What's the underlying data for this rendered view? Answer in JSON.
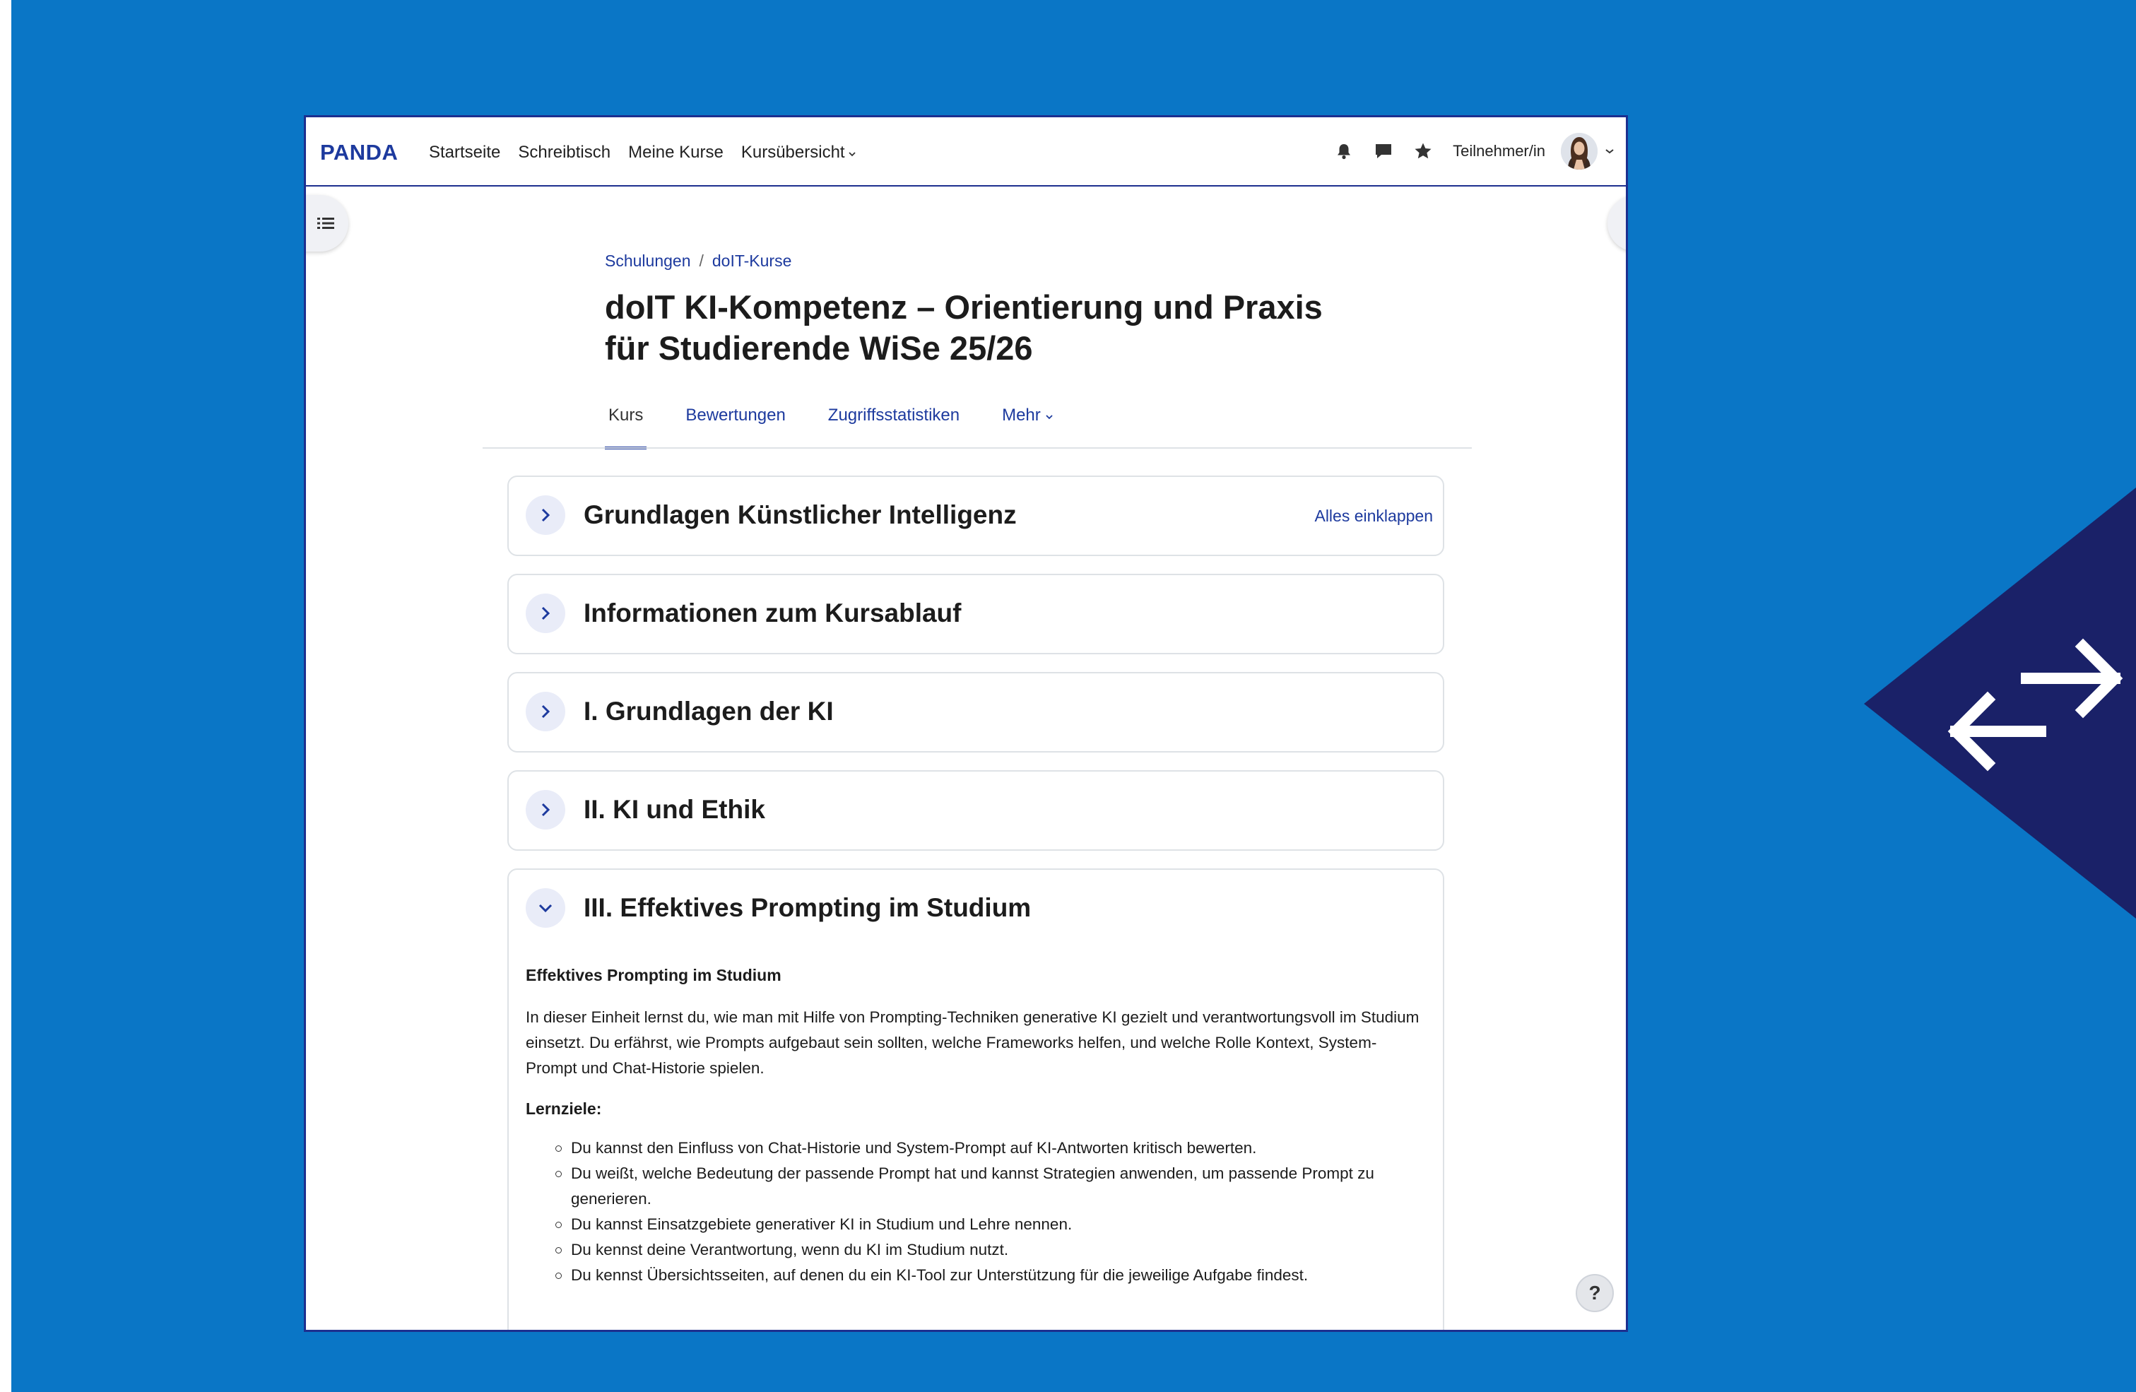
{
  "colors": {
    "background": "#0a76c6",
    "brand": "#1d3a9e",
    "deco": "#1a2168",
    "link": "#1d3a9e"
  },
  "navbar": {
    "brand": "PANDA",
    "links": [
      "Startseite",
      "Schreibtisch",
      "Meine Kurse",
      "Kursübersicht"
    ],
    "role": "Teilnehmer/in",
    "icons": [
      "bell-icon",
      "chat-icon",
      "star-icon"
    ]
  },
  "breadcrumb": [
    "Schulungen",
    "doIT-Kurse"
  ],
  "page": {
    "title_line1": "doIT KI-Kompetenz – Orientierung und Praxis",
    "title_line2": "für Studierende WiSe 25/26"
  },
  "tabs": [
    "Kurs",
    "Bewertungen",
    "Zugriffsstatistiken",
    "Mehr"
  ],
  "collapse_all": "Alles einklappen",
  "sections": [
    {
      "title": "Grundlagen Künstlicher Intelligenz",
      "expanded": false
    },
    {
      "title": "Informationen zum Kursablauf",
      "expanded": false
    },
    {
      "title": "I. Grundlagen der KI",
      "expanded": false
    },
    {
      "title": "II. KI und Ethik",
      "expanded": false
    },
    {
      "title": "III. Effektives Prompting im Studium",
      "expanded": true
    }
  ],
  "section_body": {
    "heading": "Effektives Prompting im Studium",
    "paragraph": "In dieser Einheit lernst du, wie man mit Hilfe von Prompting-Techniken generative KI gezielt und verantwortungsvoll im Studium einsetzt. Du erfährst, wie Prompts aufgebaut sein sollten, welche Frameworks helfen, und welche Rolle Kontext, System-Prompt und Chat-Historie spielen.",
    "goals_label": "Lernziele:",
    "goals": [
      "Du kannst den Einfluss von Chat-Historie und System-Prompt auf KI-Antworten kritisch bewerten.",
      "Du weißt, welche Bedeutung der passende Prompt hat und kannst Strategien anwenden, um passende Prompt zu generieren.",
      "Du kannst Einsatzgebiete generativer KI in Studium und Lehre nennen.",
      "Du kennst deine Verantwortung, wenn du KI im Studium nutzt.",
      "Du kennst Übersichtsseiten, auf denen du ein KI-Tool zur Unterstützung für die jeweilige  Aufgabe findest."
    ]
  },
  "help_label": "?"
}
